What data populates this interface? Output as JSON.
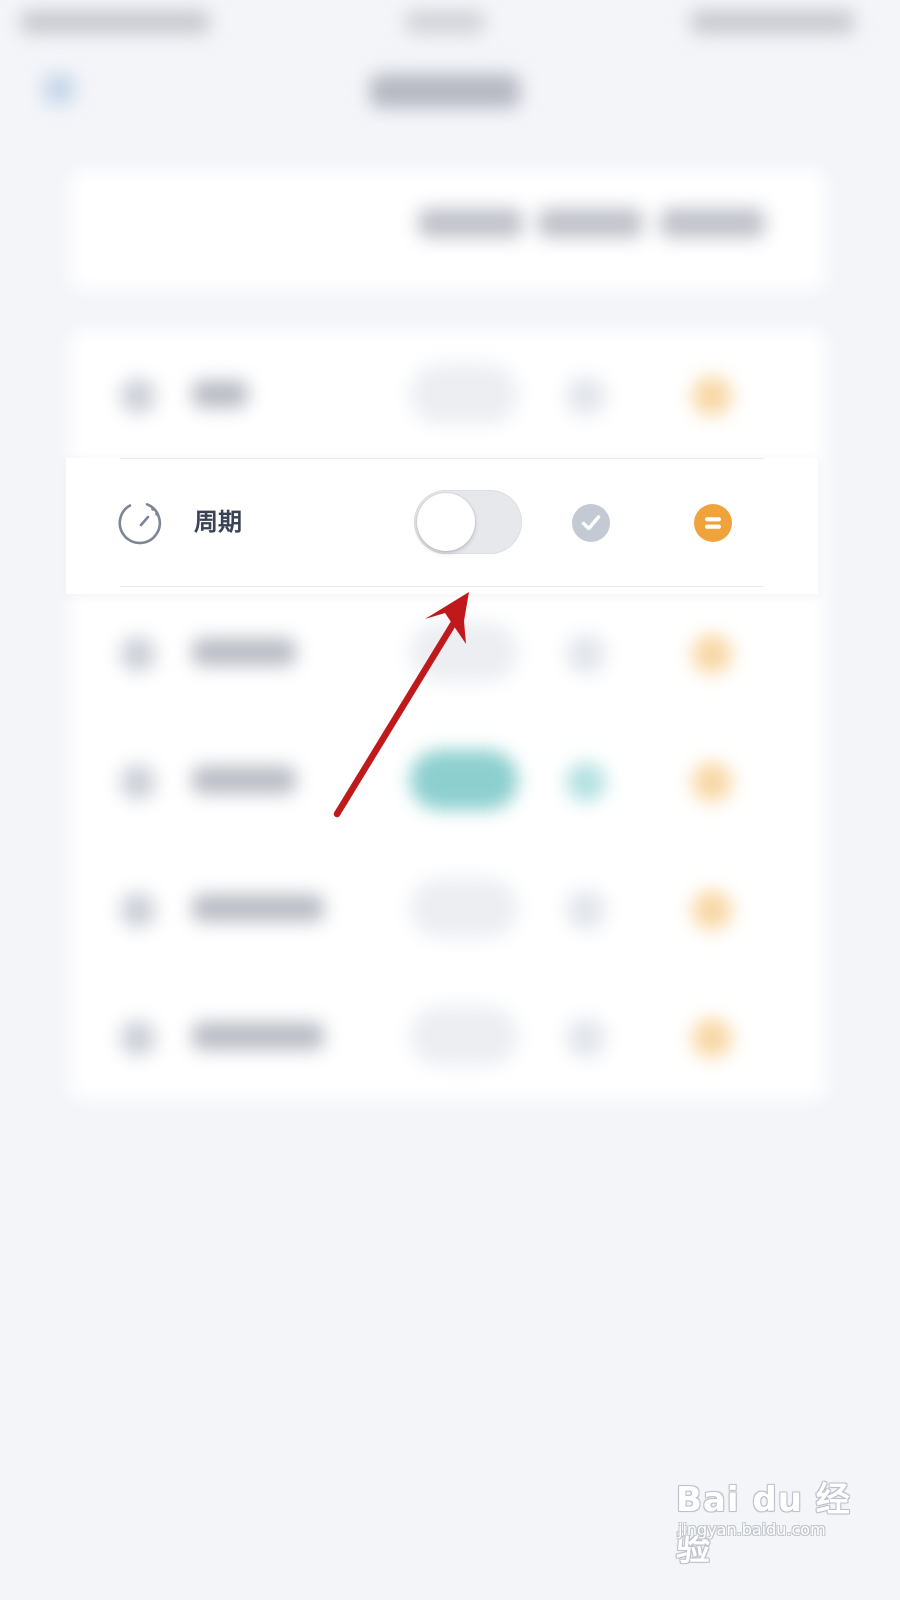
{
  "focused_row": {
    "label": "周期",
    "icon": "timer-icon",
    "toggle_on": false,
    "check_icon": "checkmark-icon",
    "handle_icon": "drag-handle-icon"
  },
  "colors": {
    "background": "#f4f5f9",
    "label": "#3a4256",
    "toggle_track": "#e7e8ec",
    "check": "#c3cad3",
    "handle": "#f0a23b",
    "annotation_arrow": "#c0191b"
  },
  "watermark": {
    "logo": "Bai du 经验",
    "url": "jingyan.baidu.com"
  }
}
